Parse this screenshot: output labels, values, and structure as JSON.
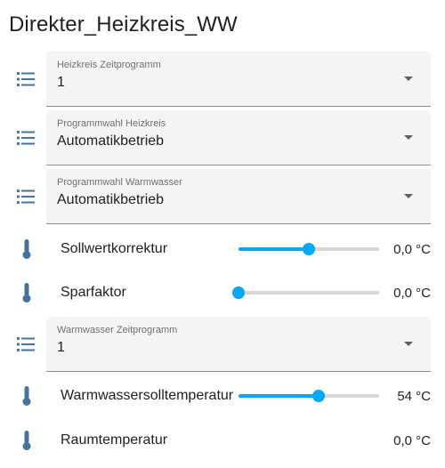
{
  "card": {
    "title": "Direkter_Heizkreis_WW"
  },
  "rows": [
    {
      "kind": "select",
      "icon": "format-list-bulleted-icon",
      "label": "Heizkreis Zeitprogramm",
      "value": "1"
    },
    {
      "kind": "select",
      "icon": "format-list-bulleted-icon",
      "label": "Programmwahl Heizkreis",
      "value": "Automatikbetrieb"
    },
    {
      "kind": "select",
      "icon": "format-list-bulleted-icon",
      "label": "Programmwahl Warmwasser",
      "value": "Automatikbetrieb"
    },
    {
      "kind": "slider",
      "icon": "thermometer-icon",
      "name": "Sollwertkorrektur",
      "state": "0,0 °C",
      "fraction": 0.5
    },
    {
      "kind": "slider",
      "icon": "thermometer-icon",
      "name": "Sparfaktor",
      "state": "0,0 °C",
      "fraction": 0.0
    },
    {
      "kind": "select",
      "icon": "format-list-bulleted-icon",
      "label": "Warmwasser Zeitprogramm",
      "value": "1"
    },
    {
      "kind": "slider",
      "icon": "thermometer-icon",
      "name": "Warmwassersolltemperatur",
      "state": "54 °C",
      "fraction": 0.57
    },
    {
      "kind": "sensor",
      "icon": "thermometer-icon",
      "name": "Raumtemperatur",
      "state": "0,0 °C"
    }
  ],
  "colors": {
    "accent": "#03a9f4",
    "icon": "#44739e"
  }
}
